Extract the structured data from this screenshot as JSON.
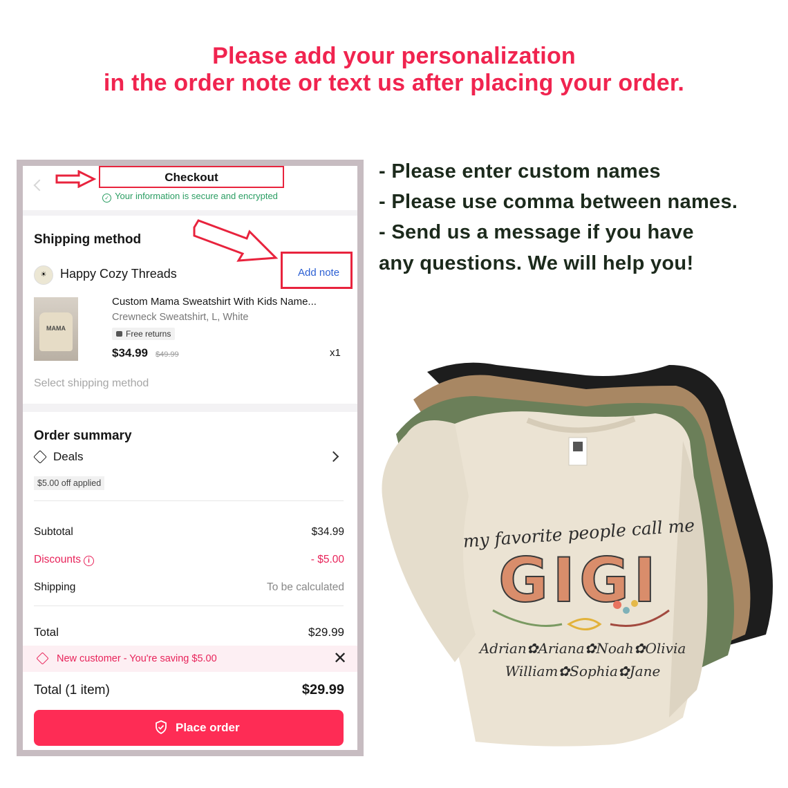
{
  "headline": {
    "line1": "Please add your personalization",
    "line2": "in the order note or text us after placing your order."
  },
  "instructions": [
    "- Please enter custom names",
    "- Please use comma between names.",
    "- Send us a message if you have",
    "any questions. We will help you!"
  ],
  "checkout": {
    "title": "Checkout",
    "secure_text": "Your information is secure and encrypted",
    "shipping_section_title": "Shipping method",
    "shop_name": "Happy Cozy Threads",
    "add_note_label": "Add note",
    "product": {
      "name": "Custom Mama Sweatshirt With Kids Name...",
      "variant": "Crewneck Sweatshirt, L, White",
      "badge": "Free returns",
      "price": "$34.99",
      "original_price": "$49.99",
      "quantity": "x1",
      "image_text": "MAMA"
    },
    "select_shipping_label": "Select shipping method",
    "order_summary_title": "Order summary",
    "deals_label": "Deals",
    "deal_badge": "$5.00 off applied",
    "rows": {
      "subtotal_label": "Subtotal",
      "subtotal_value": "$34.99",
      "discounts_label": "Discounts",
      "discounts_value": "- $5.00",
      "shipping_label": "Shipping",
      "shipping_value": "To be calculated",
      "total_label": "Total",
      "total_value": "$29.99"
    },
    "promo_text": "New customer - You're saving $5.00",
    "footer_total_label": "Total (1 item)",
    "footer_total_value": "$29.99",
    "place_order_label": "Place order"
  },
  "sweatshirt_print": {
    "tagline": "my favorite people call me",
    "big_word": "GIGI",
    "names_line1": "Adrian✿Ariana✿Noah✿Olivia",
    "names_line2": "William✿Sophia✿Jane"
  },
  "colors": {
    "headline": "#f0244f",
    "accent": "#fe2c55",
    "highlight_box": "#e8233d",
    "secure_green": "#2a9d62",
    "link_blue": "#2b5fd3"
  }
}
